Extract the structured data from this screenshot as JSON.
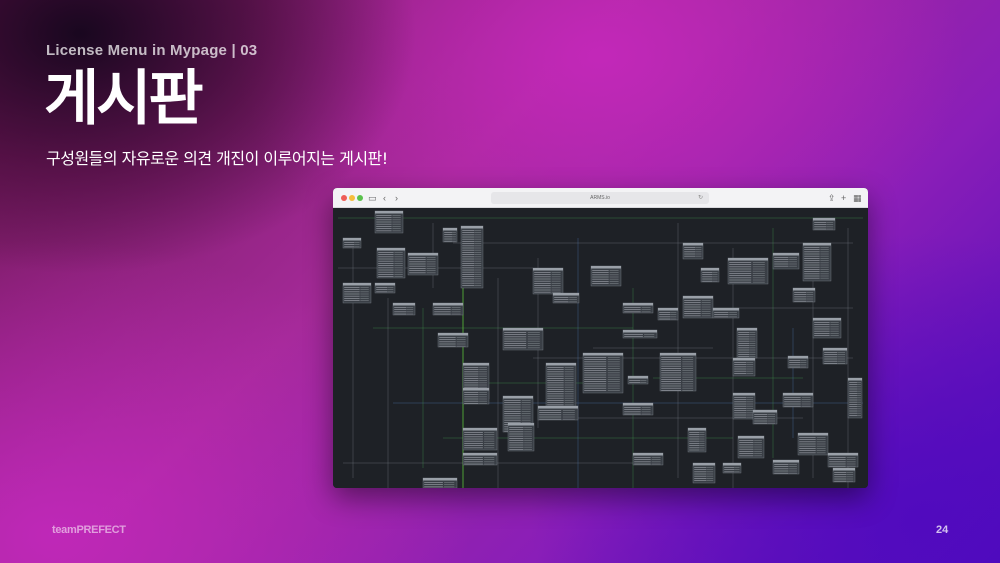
{
  "slide": {
    "subtitle": "License Menu in Mypage | 03",
    "title": "게시판",
    "description": "구성원들의 자유로운 의견 개진이 이루어지는 게시판!",
    "brand": "teamPREFECT",
    "page_number": "24"
  },
  "browser": {
    "address": "ARMS.io",
    "icons": {
      "sidebar": "sidebar-icon",
      "back": "chevron-left-icon",
      "forward": "chevron-right-icon",
      "share": "share-icon",
      "new_tab": "plus-icon",
      "tabs": "grid-icon"
    }
  },
  "colors": {
    "canvas_bg": "#1e2126",
    "table_header": "#9aa0a8",
    "table_body": "#3a3f46",
    "line_gray": "#6b7078",
    "line_green": "#3f8a4a",
    "line_blue": "#4a6aa0"
  }
}
